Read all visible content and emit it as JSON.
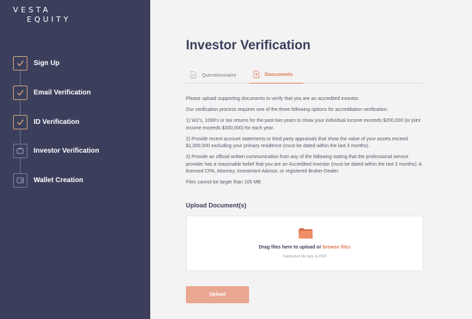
{
  "brand": {
    "line1": "VESTA",
    "line2": "EQUITY"
  },
  "steps": [
    {
      "label": "Sign Up",
      "status": "done",
      "icon": "check-icon"
    },
    {
      "label": "Email Verification",
      "status": "done",
      "icon": "check-icon"
    },
    {
      "label": "ID Verification",
      "status": "done",
      "icon": "check-icon"
    },
    {
      "label": "Investor Verification",
      "status": "current",
      "icon": "briefcase-icon"
    },
    {
      "label": "Wallet Creation",
      "status": "pending",
      "icon": "wallet-icon"
    }
  ],
  "page": {
    "title": "Investor Verification"
  },
  "tabs": [
    {
      "label": "Questionnaire",
      "icon": "document-icon",
      "active": false
    },
    {
      "label": "Documents",
      "icon": "upload-document-icon",
      "active": true
    }
  ],
  "content": {
    "intro": "Please upload supporting documents to verify that you are an accredited investor.",
    "options_intro": "Our verification process requires one of the three following options for accreditation verification:",
    "option1": "1) W2’s, 1099’s or tax returns for the past two years to show your individual income exceeds $200,000 (or joint income exceeds $300,000) for each year.",
    "option2": "2) Provide recent account statements or third party appraisals that show the value of your assets exceed $1,000,000 excluding your primary residence (must be dated within the last 3 months).",
    "option3": "3) Provide an official written communication from any of the following stating that the professional service provider has a reasonable belief that you are an Accredited Investor (must be dated within the last 3 months): A licensed CPA, Attorney, Investment Advisor, or registered Broker-Dealer.",
    "file_limit": "Files cannot be larger than 100 MB."
  },
  "upload": {
    "heading": "Upload Document(s)",
    "drop_text": "Drag files here to upload or",
    "browse_label": "browse files",
    "supported": "Supported file type is PDF",
    "button_label": "Upload"
  },
  "colors": {
    "sidebar": "#3b3f5c",
    "accent": "#e07a55",
    "button": "#eaa792",
    "step_border": "#d8a67e",
    "background": "#f3f3f3"
  }
}
